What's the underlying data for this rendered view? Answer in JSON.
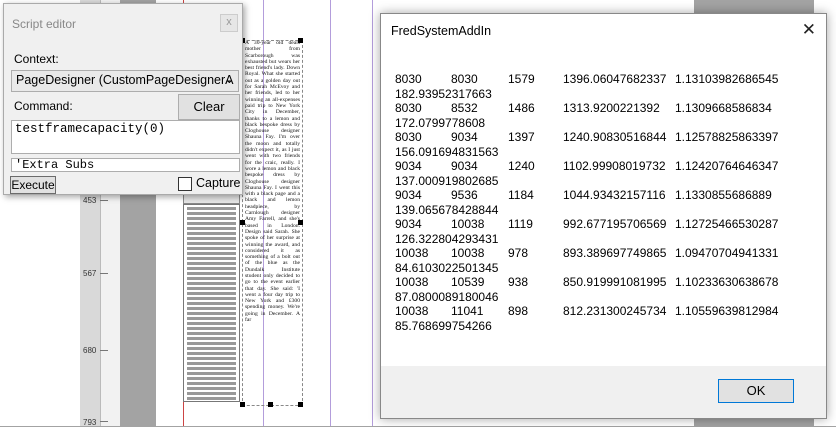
{
  "script_editor": {
    "title": "Script editor",
    "close_symbol": "x",
    "context_label": "Context:",
    "context_value": "PageDesigner (CustomPageDesignerA",
    "command_label": "Command:",
    "clear_label": "Clear",
    "command_text": "testframecapacity(0)",
    "extra_text": "'Extra Subs",
    "execute_label": "Execute",
    "capture_label": "Capture",
    "capture_checked": false
  },
  "ruler": {
    "labels": [
      "453",
      "567",
      "680",
      "793"
    ]
  },
  "page_text": "A 30-year old deals mother from Scarborough was exhausted but wears her best friend's lady. Down Royal. What she started out as a golden day out for Sarah McEvoy and her friends, led to her winning an all-expenses paid trip to New York City in December, thanks to a lemon and black bespoke dress by Cloghouse designer Shauna Fay. I'm over the moon and totally didn't expect it, as I just went with two friends for the craic, really. I wore a lemon and black bespoke dress by Cloghouse designer Shauna Fay. I went this with a black page and a black and lemon headpiece, by Carnlough designer Amy Farrell, and she's based in London. Design said Sarah. She spoke of her surprise at winning the award, and considered it as something of a bolt out of the blue as the Dundalk Institute student only decided to go to the event earlier that day. She said: 'I went a four day trip to New York and £300 spending money. We're going in December. A far",
  "dialog": {
    "title": "FredSystemAddIn",
    "close_symbol": "✕",
    "rows": [
      {
        "a": "8030",
        "b": "8030",
        "c": "1579",
        "d": "1396.06047682337",
        "e": "1.13103982686545",
        "f": "182.93952317663"
      },
      {
        "a": "8030",
        "b": "8532",
        "c": "1486",
        "d": "1313.9200221392",
        "e": "1.1309668586834",
        "f": "172.0799778608"
      },
      {
        "a": "8030",
        "b": "9034",
        "c": "1397",
        "d": "1240.90830516844",
        "e": "1.12578825863397",
        "f": "156.091694831563"
      },
      {
        "a": "9034",
        "b": "9034",
        "c": "1240",
        "d": "1102.99908019732",
        "e": "1.12420764646347",
        "f": "137.000919802685"
      },
      {
        "a": "9034",
        "b": "9536",
        "c": "1184",
        "d": "1044.93432157116",
        "e": "1.1330855686889",
        "f": "139.065678428844"
      },
      {
        "a": "9034",
        "b": "10038",
        "c": "1119",
        "d": "992.677195706569",
        "e": "1.12725466530287",
        "f": "126.322804293431"
      },
      {
        "a": "10038",
        "b": "10038",
        "c": "978",
        "d": "893.389697749865",
        "e": "1.09470704941331",
        "f": "84.6103022501345"
      },
      {
        "a": "10038",
        "b": "10539",
        "c": "938",
        "d": "850.919991081995",
        "e": "1.10233630638678",
        "f": "87.0800089180046"
      },
      {
        "a": "10038",
        "b": "11041",
        "c": "898",
        "d": "812.231300245734",
        "e": "1.10559639812984",
        "f": "85.768699754266"
      }
    ],
    "ok_label": "OK"
  }
}
